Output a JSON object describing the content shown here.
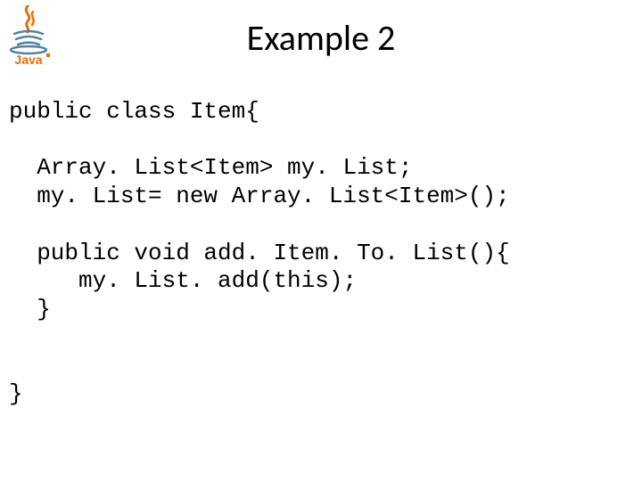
{
  "header": {
    "title": "Example 2",
    "logo_name": "java-logo"
  },
  "code": {
    "line1": "public class Item{",
    "blank1": "",
    "line2": "  Array. List<Item> my. List;",
    "line3": "  my. List= new Array. List<Item>();",
    "blank2": "",
    "line4": "  public void add. Item. To. List(){",
    "line5": "     my. List. add(this);",
    "line6": "  }",
    "blank3": "",
    "blank4": "",
    "line7": "}"
  }
}
